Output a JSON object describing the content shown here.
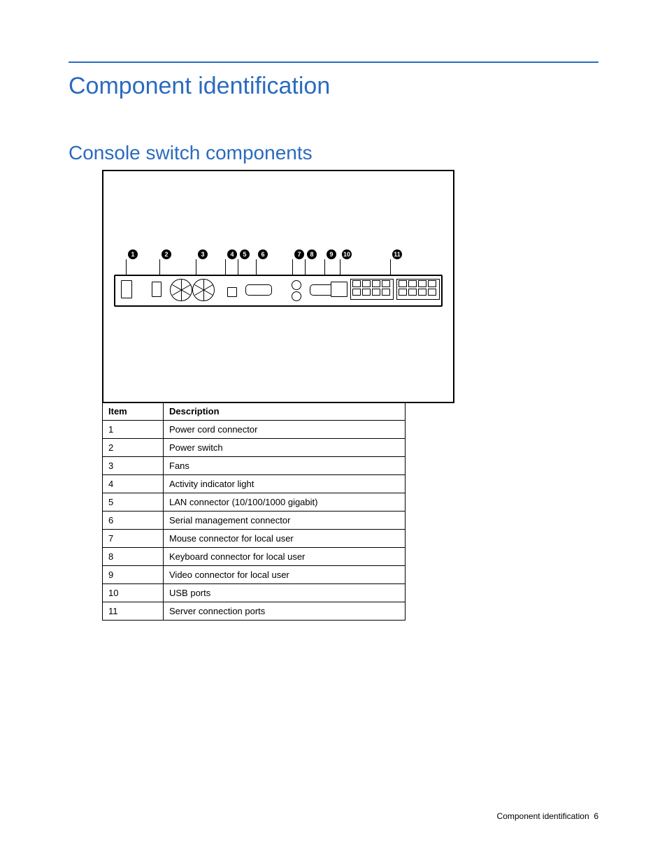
{
  "page_title": "Component identification",
  "section_title": "Console switch components",
  "callouts": [
    "1",
    "2",
    "3",
    "4",
    "5",
    "6",
    "7",
    "8",
    "9",
    "10",
    "11"
  ],
  "table": {
    "headers": [
      "Item",
      "Description"
    ],
    "rows": [
      [
        "1",
        "Power cord connector"
      ],
      [
        "2",
        "Power switch"
      ],
      [
        "3",
        "Fans"
      ],
      [
        "4",
        "Activity indicator light"
      ],
      [
        "5",
        "LAN connector (10/100/1000 gigabit)"
      ],
      [
        "6",
        "Serial management connector"
      ],
      [
        "7",
        "Mouse connector for local user"
      ],
      [
        "8",
        "Keyboard connector for local user"
      ],
      [
        "9",
        "Video connector for local user"
      ],
      [
        "10",
        "USB ports"
      ],
      [
        "11",
        "Server connection ports"
      ]
    ]
  },
  "footer_section": "Component identification",
  "footer_page": "6"
}
